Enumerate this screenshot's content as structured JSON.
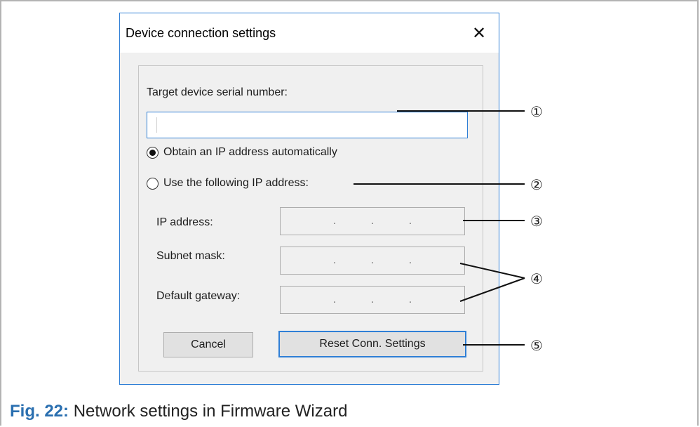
{
  "dialog": {
    "title": "Device connection settings",
    "close_glyph": "✕",
    "serial_label": "Target device serial number:",
    "serial_value": "",
    "radio_auto_label": "Obtain an IP address automatically",
    "radio_manual_label": "Use the following IP address:",
    "selected_mode": "auto",
    "ip_label": "IP address:",
    "subnet_label": "Subnet mask:",
    "gateway_label": "Default gateway:",
    "ip_dots": [
      ".",
      ".",
      "."
    ],
    "subnet_dots": [
      ".",
      ".",
      "."
    ],
    "gateway_dots": [
      ".",
      ".",
      "."
    ],
    "cancel_label": "Cancel",
    "reset_label": "Reset Conn. Settings"
  },
  "callouts": [
    "①",
    "②",
    "③",
    "④",
    "⑤"
  ],
  "caption": {
    "fig_label": "Fig. 22:",
    "text": "Network settings in Firmware Wizard"
  }
}
